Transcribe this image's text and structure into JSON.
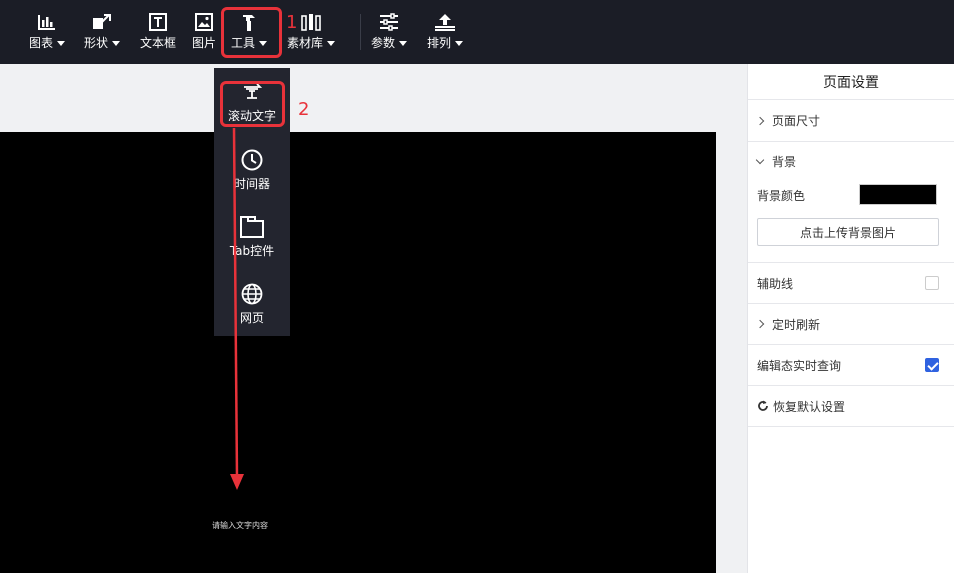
{
  "toolbar": {
    "items": [
      {
        "label": "图表",
        "icon": "bar-chart-icon",
        "dropdown": true
      },
      {
        "label": "形状",
        "icon": "shape-icon",
        "dropdown": true
      },
      {
        "label": "文本框",
        "icon": "textbox-icon",
        "dropdown": false
      },
      {
        "label": "图片",
        "icon": "image-icon",
        "dropdown": false
      },
      {
        "label": "工具",
        "icon": "tool-icon",
        "dropdown": true
      },
      {
        "label": "素材库",
        "icon": "library-icon",
        "dropdown": true
      },
      {
        "label": "参数",
        "icon": "sliders-icon",
        "dropdown": true
      },
      {
        "label": "排列",
        "icon": "arrange-icon",
        "dropdown": true
      }
    ]
  },
  "annotations": {
    "step1": "1",
    "step2": "2",
    "color": "#e8323a"
  },
  "tools_menu": {
    "items": [
      {
        "label": "滚动文字",
        "icon": "scroll-text-icon"
      },
      {
        "label": "时间器",
        "icon": "clock-icon"
      },
      {
        "label": "Tab控件",
        "icon": "tab-icon"
      },
      {
        "label": "网页",
        "icon": "globe-icon"
      }
    ]
  },
  "canvas": {
    "scroll_text_placeholder": "请输入文字内容",
    "background": "#000000"
  },
  "panel": {
    "title": "页面设置",
    "page_size": "页面尺寸",
    "background": "背景",
    "bg_color_label": "背景颜色",
    "bg_color_value": "#000000",
    "upload_bg": "点击上传背景图片",
    "guide_lines": "辅助线",
    "guide_lines_checked": false,
    "timed_refresh": "定时刷新",
    "realtime_query": "编辑态实时查询",
    "realtime_query_checked": true,
    "restore_default": "恢复默认设置"
  },
  "colors": {
    "toolbar_bg": "#1b1d26",
    "highlight": "#e8323a",
    "accent": "#2f62e0"
  }
}
